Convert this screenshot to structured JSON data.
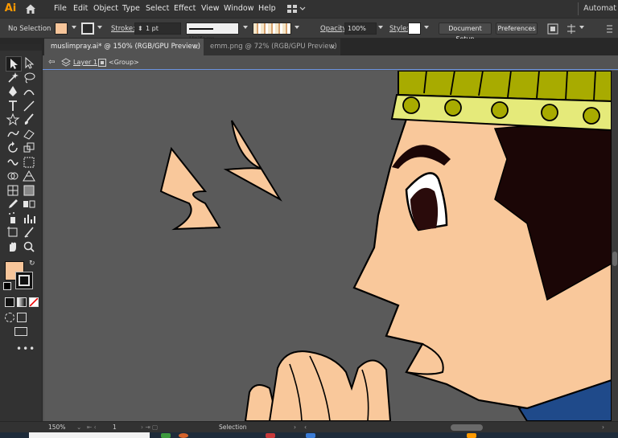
{
  "app": {
    "logo": "Ai",
    "workspace_label": "Automat"
  },
  "menu": [
    "File",
    "Edit",
    "Object",
    "Type",
    "Select",
    "Effect",
    "View",
    "Window",
    "Help"
  ],
  "control": {
    "selection": "No Selection",
    "fill_color": "#f7c59a",
    "stroke_label": "Stroke:",
    "stroke_value": "1 pt",
    "profile": "Uniform",
    "opacity_label": "Opacity:",
    "opacity_value": "100%",
    "style_label": "Style:",
    "document_setup": "Document Setup",
    "preferences": "Preferences"
  },
  "tabs": [
    {
      "label": "muslimpray.ai* @ 150% (RGB/GPU Preview)",
      "close": "×",
      "active": true
    },
    {
      "label": "emm.png @ 72% (RGB/GPU Preview)",
      "close": "×",
      "active": false
    }
  ],
  "breadcrumb": {
    "layer": "Layer 1",
    "group": "<Group>"
  },
  "tools": [
    "selection-tool",
    "direct-selection-tool",
    "magic-wand-tool",
    "lasso-tool",
    "pen-tool",
    "curvature-tool",
    "type-tool",
    "line-tool",
    "shape-tool",
    "paintbrush-tool",
    "shaper-tool",
    "eraser-tool",
    "rotate-tool",
    "scale-tool",
    "warp-tool",
    "free-transform-tool",
    "shape-builder-tool",
    "perspective-grid-tool",
    "mesh-tool",
    "gradient-tool",
    "eyedropper-tool",
    "blend-tool",
    "symbol-sprayer-tool",
    "graph-tool",
    "artboard-tool",
    "slice-tool",
    "hand-tool",
    "zoom-tool"
  ],
  "colors": {
    "fill": "#f7c59a",
    "stroke": "#000000",
    "skin": "#f9c89b",
    "hat": "#a8ab00",
    "hat_band": "#e5ea7a",
    "hair": "#1b0606",
    "shirt": "#1f4a8a",
    "accent_blue": "#6c94e0"
  },
  "status": {
    "zoom": "150%",
    "artboard": "1",
    "tool": "Selection"
  }
}
